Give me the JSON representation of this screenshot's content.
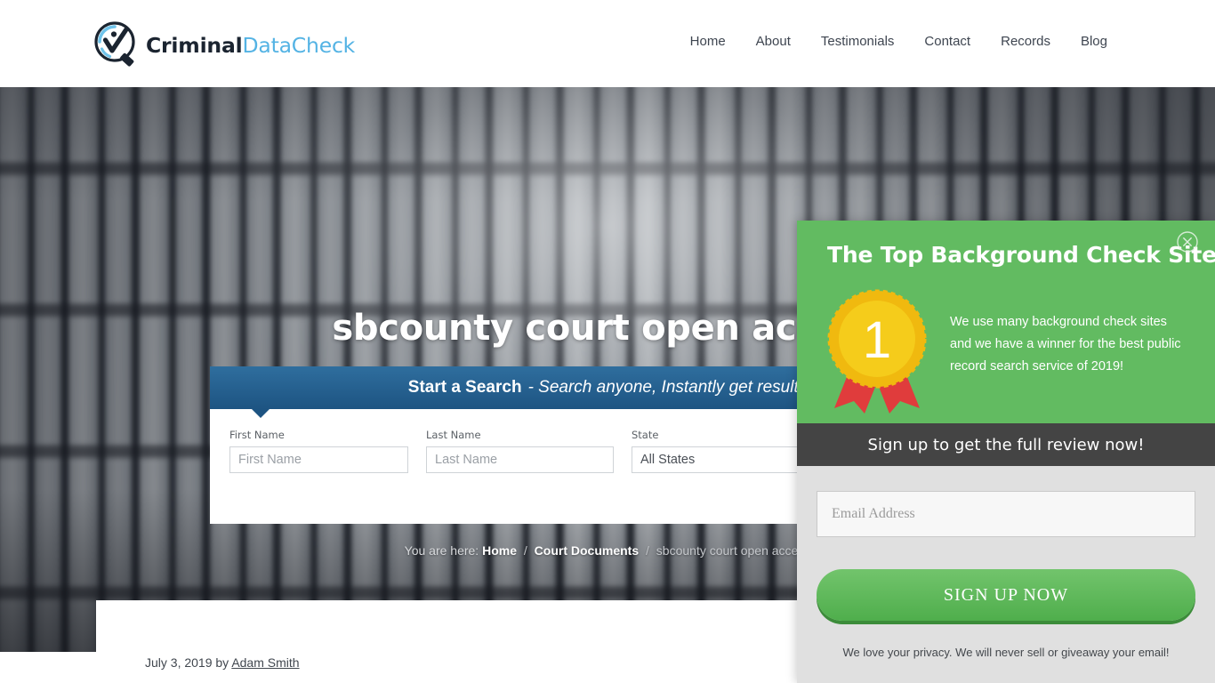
{
  "header": {
    "logo": {
      "icon": "magnifier-check-icon",
      "text_dark": "Criminal",
      "text_blue": "DataCheck"
    },
    "nav": [
      {
        "label": "Home"
      },
      {
        "label": "About"
      },
      {
        "label": "Testimonials"
      },
      {
        "label": "Contact"
      },
      {
        "label": "Records"
      },
      {
        "label": "Blog"
      }
    ]
  },
  "hero": {
    "title": "sbcounty court open access",
    "search": {
      "bar_strong": "Start a Search",
      "bar_em": "- Search anyone, Instantly get results",
      "fields": {
        "first_name_label": "First Name",
        "first_name_placeholder": "First Name",
        "first_name_value": "",
        "last_name_label": "Last Name",
        "last_name_placeholder": "Last Name",
        "last_name_value": "",
        "state_label": "State",
        "state_selected": "All States",
        "state_options": [
          "All States"
        ],
        "chevron_icon": "chevron-down-icon"
      }
    },
    "breadcrumb": {
      "prefix": "You are here:",
      "home": "Home",
      "sep": "/",
      "category": "Court Documents",
      "current": "sbcounty court open access"
    }
  },
  "content": {
    "post_date": "July 3, 2019",
    "by_text": "by",
    "author": "Adam Smith"
  },
  "popup": {
    "close_icon": "close-circle-icon",
    "title": "The Top Background Check Sites",
    "badge_icon": "first-place-ribbon-icon",
    "badge_number": "1",
    "copy": "We use many background check sites and we have a winner for the best public record search service of 2019!",
    "subbar": "Sign up to get the full review now!",
    "email_placeholder": "Email Address",
    "email_value": "",
    "signup_label": "SIGN UP NOW",
    "privacy": "We love your privacy.  We will never sell or giveaway your email!"
  },
  "colors": {
    "brand_blue": "#54b3e4",
    "search_bar_blue": "#2f6e9e",
    "popup_green": "#62bb61",
    "popup_dark": "#444444",
    "badge_gold": "#f5c518",
    "badge_ribbon_red": "#e03c3c",
    "button_green": "#4fae4c"
  }
}
